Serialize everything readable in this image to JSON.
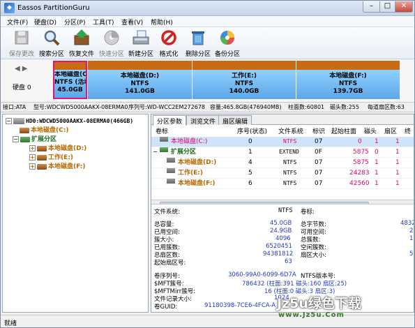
{
  "window": {
    "title": "Eassos PartitionGuru",
    "app_icon": "partitionguru-app-icon"
  },
  "menu": [
    "文件(F)",
    "硬盘(D)",
    "分区(P)",
    "工具(T)",
    "查看(V)",
    "帮助(H)"
  ],
  "toolbar": [
    {
      "label": "保存更改",
      "icon": "save-icon",
      "enabled": false
    },
    {
      "label": "搜索分区",
      "icon": "search-icon",
      "enabled": true
    },
    {
      "label": "恢复文件",
      "icon": "recover-files-icon",
      "enabled": true
    },
    {
      "label": "快速分区",
      "icon": "quick-partition-icon",
      "enabled": false
    },
    {
      "label": "新建分区",
      "icon": "new-partition-icon",
      "enabled": true
    },
    {
      "label": "格式化",
      "icon": "format-icon",
      "enabled": true
    },
    {
      "label": "删除分区",
      "icon": "delete-partition-icon",
      "enabled": true
    },
    {
      "label": "备份分区",
      "icon": "backup-partition-icon",
      "enabled": true
    }
  ],
  "disk_label": "硬盘 0",
  "partitions_bar": [
    {
      "name": "本地磁盘(C:)",
      "fs": "NTFS (活动)",
      "size": "45.0GB",
      "selected": true
    },
    {
      "name": "本地磁盘(D:)",
      "fs": "NTFS",
      "size": "141.0GB",
      "selected": false
    },
    {
      "name": "工作(E:)",
      "fs": "NTFS",
      "size": "140.0GB",
      "selected": false
    },
    {
      "name": "本地磁盘(F:)",
      "fs": "NTFS",
      "size": "139.7GB",
      "selected": false
    }
  ],
  "disk_info": {
    "interface": "接口:ATA",
    "model": "型号:WDCWD5000AAKX-08ERMA0",
    "serial": "序列号:WD-WCC2EM272678",
    "capacity": "容量:465.8GB(476940MB)",
    "cylinders": "柱面数:60801",
    "heads": "磁头数:255",
    "sectors": "每道扇区数:63"
  },
  "tree": {
    "disk": "HD0:WDCWD5000AAKX-08ERMA0(466GB)",
    "c": "本地磁盘(C:)",
    "ext": "扩展分区",
    "d": "本地磁盘(D:)",
    "e": "工作(E:)",
    "f": "本地磁盘(F:)"
  },
  "tabs": [
    "分区参数",
    "浏览文件",
    "扇区编辑"
  ],
  "grid": {
    "headers": [
      "卷标",
      "序号(状态)",
      "文件系统",
      "标识",
      "起始柱面",
      "磁头",
      "扇区",
      "终"
    ],
    "rows": [
      {
        "name": "本地磁盘(C:)",
        "no": "0",
        "fs": "NTFS",
        "id": "07",
        "cyl": "0",
        "head": "1",
        "sec": "1"
      },
      {
        "name": "扩展分区",
        "no": "1",
        "fs": "EXTEND",
        "id": "0F",
        "cyl": "5875",
        "head": "0",
        "sec": "1"
      },
      {
        "name": "本地磁盘(D:)",
        "no": "4",
        "fs": "NTFS",
        "id": "07",
        "cyl": "5875",
        "head": "1",
        "sec": "1"
      },
      {
        "name": "工作(E:)",
        "no": "5",
        "fs": "NTFS",
        "id": "07",
        "cyl": "24283",
        "head": "1",
        "sec": "1"
      },
      {
        "name": "本地磁盘(F:)",
        "no": "6",
        "fs": "NTFS",
        "id": "07",
        "cyl": "42560",
        "head": "1",
        "sec": "1"
      }
    ]
  },
  "details": {
    "fs_label": "文件系统:",
    "fs_value": "NTFS",
    "vol_label": "卷标:",
    "total_cap_label": "总容量:",
    "total_cap": "45.0GB",
    "used_label": "已用空间:",
    "used": "24.9GB",
    "cluster_size_label": "簇大小:",
    "cluster_size": "4096",
    "used_clusters_label": "已用簇数:",
    "used_clusters": "6520451",
    "total_sectors_label": "总扇区数:",
    "total_sectors": "94381812",
    "start_sector_label": "起始扇区号:",
    "start_sector": "63",
    "total_bytes_label": "总字节数:",
    "total_bytes": "4832",
    "free_label": "可用空间:",
    "free": "2",
    "total_clusters_label": "总簇数:",
    "total_clusters": "1",
    "free_clusters_label": "空闲簇数:",
    "free_clusters": "",
    "sector_size_label": "扇区大小:",
    "sector_size": "5",
    "serial_label": "卷序列号:",
    "serial": "3060-99A0-6099-6D7A",
    "ntfs_ver_label": "NTFS版本号:",
    "mft_label": "$MFT簇号:",
    "mft": "786432 (柱面:391 磁头:160 扇区:25)",
    "mftmirr_label": "$MFTMirr簇号:",
    "mftmirr": "16 (柱面:0 磁头:3 扇区:3)",
    "record_size_label": "文件记录大小:",
    "record_size": "1024",
    "guid_label": "卷GUID:",
    "guid": "91180398-7CE6-4FCA-A"
  },
  "status": "就绪",
  "watermark": {
    "big": "Jz5u绿色下载",
    "url": "www.Jz5u.Com"
  }
}
